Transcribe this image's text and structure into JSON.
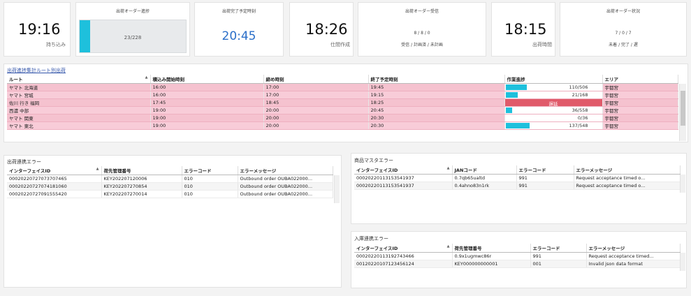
{
  "kpis": {
    "k1": {
      "time": "19:16",
      "sub": "持ち込み"
    },
    "k2": {
      "title": "出荷オーダー進捗",
      "progress_text": "23/228",
      "progress_fraction": 0.1
    },
    "k3": {
      "title": "出荷完了予定時刻",
      "time": "20:45"
    },
    "k4": {
      "time": "18:26",
      "sub": "仕間作成"
    },
    "k5": {
      "title": "出荷オーダー受信",
      "line1": "8 / 8 / 0",
      "line2": "受信 / 計画済 / 未計画"
    },
    "k6": {
      "time": "18:15",
      "sub": "出荷時間"
    },
    "k7": {
      "title": "出荷オーダー状況",
      "line1": "7 / 0 / 7",
      "line2": "未着 / 完了 / 遅"
    }
  },
  "route_panel": {
    "title": "出荷進捗集計ルート別出荷",
    "headers": [
      "ルート",
      "積込み開始時刻",
      "締め時刻",
      "終了予定時刻",
      "作業進捗",
      "エリア"
    ],
    "rows": [
      {
        "route": "ヤマト 北海道",
        "start": "16:00",
        "cutoff": "17:00",
        "end": "19:45",
        "progress": "110/506",
        "fraction": 0.217,
        "area": "宇都宮"
      },
      {
        "route": "ヤマト 宮城",
        "start": "16:00",
        "cutoff": "17:00",
        "end": "19:15",
        "progress": "21/168",
        "fraction": 0.125,
        "area": "宇都宮"
      },
      {
        "route": "佐川 行き 福岡",
        "start": "17:45",
        "cutoff": "18:45",
        "end": "18:25",
        "progress": "遅延",
        "fraction": 1,
        "error": true,
        "area": "宇都宮"
      },
      {
        "route": "西濃 中部",
        "start": "19:00",
        "cutoff": "20:00",
        "end": "20:45",
        "progress": "36/558",
        "fraction": 0.065,
        "area": "宇都宮"
      },
      {
        "route": "ヤマト 関東",
        "start": "19:00",
        "cutoff": "20:00",
        "end": "20:30",
        "progress": "0/36",
        "fraction": 0,
        "area": "宇都宮"
      },
      {
        "route": "ヤマト 東北",
        "start": "19:00",
        "cutoff": "20:00",
        "end": "20:30",
        "progress": "137/548",
        "fraction": 0.25,
        "area": "宇都宮"
      }
    ]
  },
  "outbound_err": {
    "title": "出荷連携エラー",
    "headers": [
      "インターフェイスID",
      "荷先管理番号",
      "エラーコード",
      "エラーメッセージ"
    ],
    "rows": [
      [
        "00020220727073707465",
        "KEY202207120006",
        "010",
        "Outbound order OUBA022000..."
      ],
      [
        "00020220727074181060",
        "KEY202207270854",
        "010",
        "Outbound order OUBA022000..."
      ],
      [
        "00020220727091555420",
        "KEY202207270014",
        "010",
        "Outbound order OUBA022000..."
      ]
    ]
  },
  "product_err": {
    "title": "商品マスタエラー",
    "headers": [
      "インターフェイスID",
      "JANコード",
      "エラーコード",
      "エラーメッセージ"
    ],
    "rows": [
      [
        "00020220113153541937",
        "0.7qb65ualtd",
        "991",
        "Request acceptance timed o..."
      ],
      [
        "00020220113153541937",
        "0.4ahno83n1rk",
        "991",
        "Request acceptance timed o..."
      ]
    ]
  },
  "inbound_err": {
    "title": "入庫連携エラー",
    "headers": [
      "インターフェイスID",
      "荷先管理番号",
      "エラーコード",
      "エラーメッセージ"
    ],
    "rows": [
      [
        "00020220113192743466",
        "0.9x1ugmwc86r",
        "991",
        "Request acceptance timed..."
      ],
      [
        "00120220107123456124",
        "KEY000000000001",
        "001",
        "Invalid json data format"
      ]
    ]
  },
  "colors": {
    "accent": "#1ec0dc",
    "route_row": "#f5c2cf",
    "error": "#e05a6a",
    "time_blue": "#2b6fc9"
  }
}
